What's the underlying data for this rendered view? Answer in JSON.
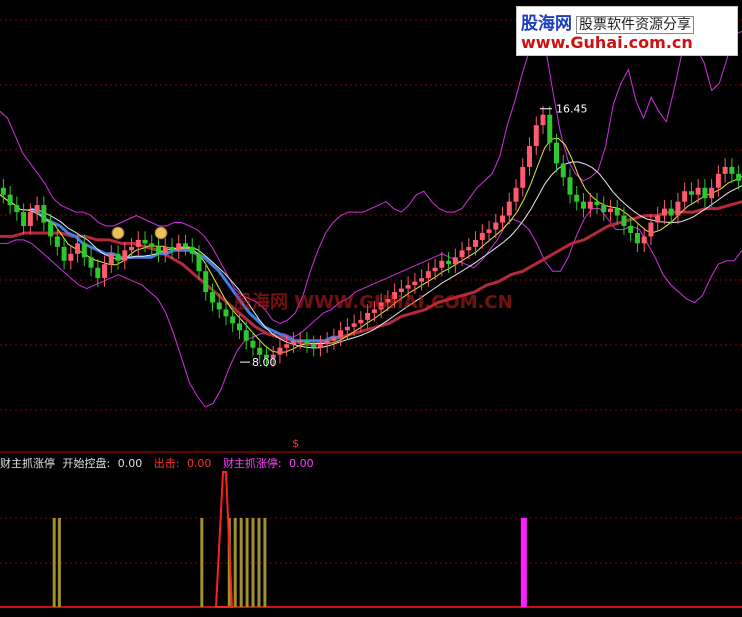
{
  "logo": {
    "name": "股海网",
    "tagline": "股票软件资源分享",
    "url": "www.Guhai.com.cn"
  },
  "watermark": "股海网 WWW.GUHAI.COM.CN",
  "annotations": {
    "high_label": "16.45",
    "low_label": "8.00",
    "buy_marker": "$"
  },
  "subchart": {
    "name": "财主抓涨停",
    "items": [
      {
        "label": "开始控盘:",
        "value": "0.00",
        "color": "#e0e0e0"
      },
      {
        "label": "出击:",
        "value": "0.00",
        "color": "#ff3030"
      },
      {
        "label": "财主抓涨停:",
        "value": "0.00",
        "color": "#ff40ff"
      }
    ]
  },
  "colors": {
    "up": "#ff5a6e",
    "down": "#2ec82e",
    "ma_blue": "#3f7fe0",
    "ma_long": "#b8283c",
    "boll": "#d030e0",
    "grid": "#8a0000"
  },
  "chart_data": {
    "type": "candlestick",
    "ylim": [
      6,
      19
    ],
    "close": [
      13.4,
      13.1,
      12.9,
      12.5,
      12.9,
      13.1,
      12.6,
      12.2,
      11.9,
      11.5,
      11.7,
      12.0,
      11.6,
      11.3,
      11.0,
      11.4,
      11.7,
      11.5,
      11.8,
      11.9,
      12.1,
      12.0,
      11.9,
      11.7,
      11.9,
      11.8,
      12.0,
      11.9,
      11.7,
      11.2,
      10.6,
      10.3,
      10.1,
      9.9,
      9.7,
      9.5,
      9.2,
      9.0,
      8.8,
      8.7,
      8.8,
      9.0,
      9.1,
      9.2,
      9.2,
      9.1,
      9.0,
      9.1,
      9.2,
      9.3,
      9.5,
      9.6,
      9.7,
      9.8,
      10.0,
      10.1,
      10.3,
      10.4,
      10.6,
      10.7,
      10.8,
      10.9,
      11.0,
      11.2,
      11.3,
      11.5,
      11.4,
      11.6,
      11.8,
      11.9,
      12.1,
      12.3,
      12.4,
      12.6,
      12.8,
      13.2,
      13.6,
      14.2,
      14.8,
      15.4,
      15.7,
      14.9,
      14.3,
      13.9,
      13.4,
      13.2,
      13.0,
      13.2,
      13.1,
      12.9,
      13.0,
      12.8,
      12.5,
      12.3,
      12.0,
      12.2,
      12.6,
      12.8,
      13.0,
      12.8,
      13.2,
      13.5,
      13.4,
      13.6,
      13.3,
      13.6,
      14.0,
      14.2,
      14.0,
      13.8
    ],
    "bollinger": {
      "upper": [
        15.8,
        15.6,
        15.1,
        14.6,
        14.3,
        14.0,
        13.7,
        13.3,
        13.1,
        13.0,
        12.9,
        12.9,
        12.8,
        12.6,
        12.5,
        12.5,
        12.6,
        12.7,
        12.8,
        12.7,
        12.6,
        12.5,
        12.5,
        12.6,
        12.6,
        12.5,
        12.4,
        12.2,
        11.9,
        11.5,
        11.1,
        10.7,
        10.5,
        10.4,
        10.3,
        10.1,
        9.8,
        9.7,
        9.8,
        10.0,
        10.5,
        11.2,
        11.8,
        12.3,
        12.6,
        12.8,
        12.9,
        12.9,
        12.9,
        13.0,
        13.1,
        13.2,
        13.0,
        12.9,
        13.1,
        13.4,
        13.5,
        13.2,
        13.0,
        12.9,
        12.9,
        13.0,
        13.3,
        13.6,
        13.8,
        14.0,
        14.5,
        15.4,
        16.1,
        16.9,
        17.6,
        17.9,
        17.7,
        16.4,
        15.2,
        14.4,
        14.0,
        13.8,
        13.9,
        14.1,
        14.8,
        16.0,
        16.6,
        17.0,
        16.1,
        15.6,
        16.2,
        15.8,
        15.5,
        16.4,
        17.4,
        17.6,
        17.6,
        17.2,
        16.4,
        16.6,
        17.3,
        18.0,
        18.1
      ],
      "lower": [
        12.0,
        12.0,
        12.1,
        12.1,
        12.0,
        11.8,
        11.6,
        11.4,
        11.2,
        11.0,
        10.8,
        10.7,
        10.8,
        10.9,
        11.0,
        11.1,
        11.0,
        10.9,
        10.8,
        10.6,
        10.4,
        10.0,
        9.4,
        8.7,
        8.0,
        7.6,
        7.3,
        7.4,
        7.8,
        8.4,
        8.9,
        9.2,
        9.3,
        9.4,
        9.4,
        9.4,
        9.4,
        9.3,
        9.4,
        9.6,
        9.8,
        10.0,
        10.1,
        10.3,
        10.4,
        10.6,
        10.7,
        10.8,
        10.9,
        11.0,
        11.1,
        11.2,
        11.3,
        11.4,
        11.5,
        11.6,
        11.7,
        11.6,
        11.5,
        11.4,
        11.3,
        11.5,
        11.8,
        12.1,
        12.5,
        12.7,
        12.6,
        12.4,
        12.0,
        11.5,
        11.2,
        11.2,
        11.6,
        12.2,
        12.7,
        13.0,
        13.0,
        12.7,
        12.4,
        12.4,
        12.5,
        12.4,
        12.0,
        11.6,
        11.1,
        10.8,
        10.6,
        10.4,
        10.3,
        10.5,
        11.0,
        11.4,
        11.5,
        11.5,
        11.8
      ]
    },
    "ma_blue": [
      13.0,
      12.9,
      12.7,
      12.6,
      12.5,
      12.3,
      12.2,
      12.0,
      11.9,
      11.8,
      11.7,
      11.7,
      11.6,
      11.6,
      11.6,
      11.6,
      11.6,
      11.7,
      11.7,
      11.8,
      11.8,
      11.8,
      11.7,
      11.6,
      11.4,
      11.2,
      10.9,
      10.6,
      10.3,
      10.0,
      9.8,
      9.6,
      9.5,
      9.4,
      9.3,
      9.2,
      9.2,
      9.2,
      9.2,
      9.2,
      9.3,
      9.3
    ],
    "ma_long": [
      12.2,
      12.2,
      12.3,
      12.3,
      12.3,
      12.3,
      12.2,
      12.2,
      12.1,
      12.1,
      12.0,
      12.0,
      11.9,
      11.8,
      11.6,
      11.4,
      11.1,
      10.8,
      10.5,
      10.2,
      9.9,
      9.6,
      9.4,
      9.3,
      9.2,
      9.1,
      9.1,
      9.2,
      9.3,
      9.4,
      9.5,
      9.6,
      9.7,
      9.9,
      10.0,
      10.1,
      10.3,
      10.4,
      10.5,
      10.6,
      10.8,
      10.9,
      11.1,
      11.2,
      11.4,
      11.6,
      11.8,
      12.0,
      12.1,
      12.3,
      12.5,
      12.6,
      12.7,
      12.8,
      12.8,
      12.9,
      12.9,
      12.9,
      13.0,
      13.0,
      13.1,
      13.2
    ],
    "subchart_bars": [
      {
        "x": 0.073,
        "type": "olive"
      },
      {
        "x": 0.08,
        "type": "olive"
      },
      {
        "x": 0.272,
        "type": "olive"
      },
      {
        "x": 0.309,
        "type": "olive"
      },
      {
        "x": 0.317,
        "type": "olive"
      },
      {
        "x": 0.325,
        "type": "olive"
      },
      {
        "x": 0.333,
        "type": "olive"
      },
      {
        "x": 0.341,
        "type": "olive"
      },
      {
        "x": 0.349,
        "type": "olive"
      },
      {
        "x": 0.357,
        "type": "olive"
      },
      {
        "x": 0.706,
        "type": "magenta"
      }
    ]
  }
}
